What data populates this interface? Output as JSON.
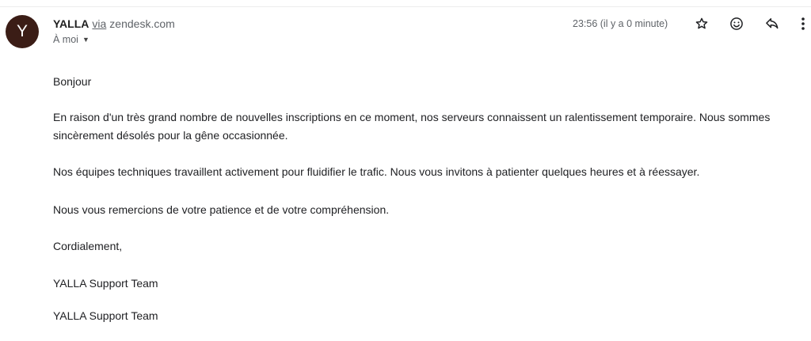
{
  "sender": {
    "avatar_letter": "Y",
    "avatar_color": "#3b1d16",
    "name": "YALLA",
    "via_label": "via",
    "domain": "zendesk.com"
  },
  "recipient": {
    "label": "À moi",
    "dropdown_icon": "caret-down-icon"
  },
  "timestamp": "23:56 (il y a 0 minute)",
  "actions": {
    "star_icon": "star-icon",
    "emoji_icon": "emoji-smile-icon",
    "reply_icon": "reply-icon",
    "more_icon": "more-vertical-icon"
  },
  "message": {
    "greeting": "Bonjour",
    "paragraph1": "En raison d'un très grand nombre de nouvelles inscriptions en ce moment, nos serveurs connaissent un ralentissement temporaire. Nous sommes sincèrement désolés pour la gêne occasionnée.",
    "paragraph2": "Nos équipes techniques travaillent activement pour fluidifier le trafic. Nous vous invitons à patienter quelques heures et à réessayer.",
    "paragraph3": "Nous vous remercions de votre patience et de votre compréhension.",
    "closing": "Cordialement,",
    "signature1": "YALLA Support Team",
    "signature2": "YALLA Support Team"
  }
}
